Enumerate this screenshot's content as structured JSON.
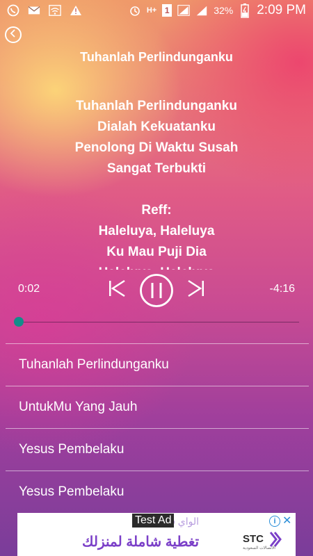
{
  "status_bar": {
    "battery_percent": "32%",
    "clock": "2:09 PM",
    "network_label": "H+",
    "sim_label": "1",
    "icons": [
      "whatsapp-icon",
      "mail-icon",
      "wifi-icon",
      "warning-icon",
      "alarm-icon",
      "network-icon",
      "sim-icon",
      "signal-icon",
      "signal-icon-2",
      "battery-icon"
    ]
  },
  "player": {
    "song_title": "Tuhanlah Perlindunganku",
    "lyrics": [
      "Tuhanlah Perlindunganku",
      "Dialah Kekuatanku",
      "Penolong Di Waktu Susah",
      "Sangat Terbukti",
      "",
      "Reff:",
      "Haleluya, Haleluya",
      "Ku Mau Puji Dia",
      "Haleluya, Haleluya"
    ],
    "elapsed": "0:02",
    "remaining": "-4:16",
    "progress_fraction": 0.008,
    "accent_color": "#128d8a"
  },
  "playlist": {
    "items": [
      {
        "label": "Tuhanlah Perlindunganku"
      },
      {
        "label": "UntukMu Yang Jauh"
      },
      {
        "label": "Yesus Pembelaku"
      },
      {
        "label": "Yesus Pembelaku"
      }
    ]
  },
  "ad": {
    "label": "Test Ad",
    "line1": "الواي فاي",
    "line2": "تغطية شاملة لمنزلك",
    "brand": "STC",
    "brand_sub": "الاتصالات السعودية"
  }
}
